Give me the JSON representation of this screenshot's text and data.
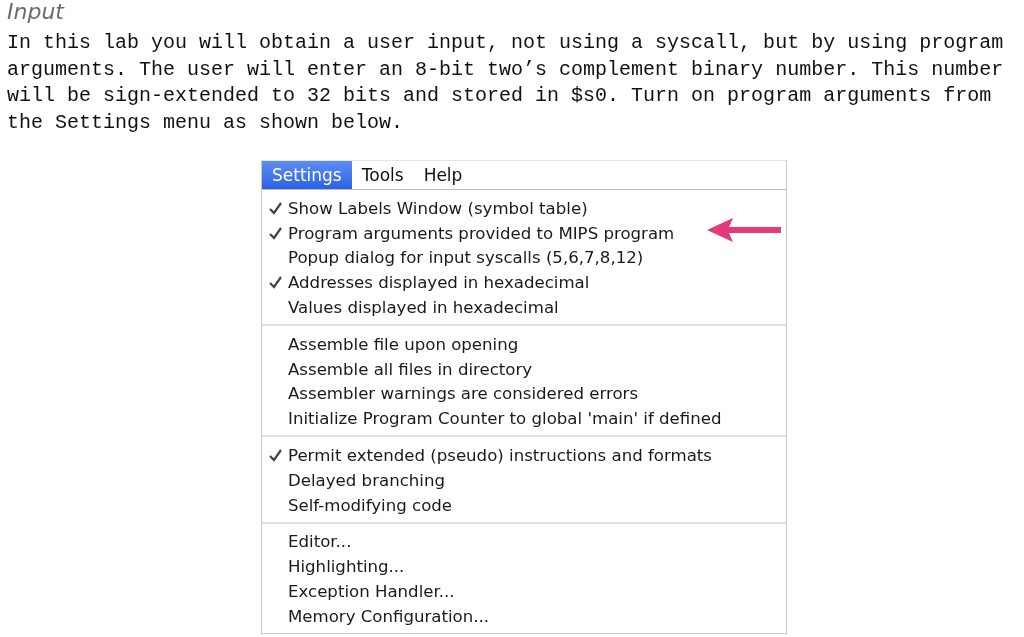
{
  "heading": "Input",
  "paragraph": "In this lab you will obtain a user input, not using a syscall, but by using program arguments. The user will enter an 8-bit two’s complement binary number. This number will be sign-extended to 32 bits and stored in $s0. Turn on program arguments from the Settings menu as shown below.",
  "menubar": [
    {
      "label": "Settings",
      "selected": true
    },
    {
      "label": "Tools",
      "selected": false
    },
    {
      "label": "Help",
      "selected": false
    }
  ],
  "menu_groups": [
    {
      "items": [
        {
          "label": "Show Labels Window (symbol table)",
          "checked": true
        },
        {
          "label": "Program arguments provided to MIPS program",
          "checked": true,
          "pointed": true
        },
        {
          "label": "Popup dialog for input syscalls (5,6,7,8,12)",
          "checked": false
        },
        {
          "label": "Addresses displayed in hexadecimal",
          "checked": true
        },
        {
          "label": "Values displayed in hexadecimal",
          "checked": false
        }
      ]
    },
    {
      "items": [
        {
          "label": "Assemble file upon opening",
          "checked": false
        },
        {
          "label": "Assemble all files in directory",
          "checked": false
        },
        {
          "label": "Assembler warnings are considered errors",
          "checked": false
        },
        {
          "label": "Initialize Program Counter to global 'main' if defined",
          "checked": false
        }
      ]
    },
    {
      "items": [
        {
          "label": "Permit extended (pseudo) instructions and formats",
          "checked": true
        },
        {
          "label": "Delayed branching",
          "checked": false
        },
        {
          "label": "Self-modifying code",
          "checked": false
        }
      ]
    },
    {
      "items": [
        {
          "label": "Editor...",
          "checked": false
        },
        {
          "label": "Highlighting...",
          "checked": false
        },
        {
          "label": "Exception Handler...",
          "checked": false
        },
        {
          "label": "Memory Configuration...",
          "checked": false
        }
      ]
    }
  ]
}
